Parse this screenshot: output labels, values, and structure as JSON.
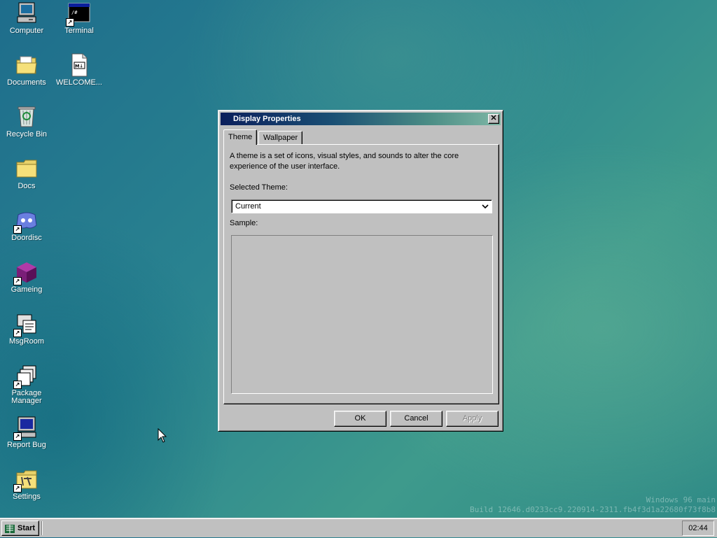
{
  "desktop": {
    "icons": [
      {
        "label": "Computer",
        "icon": "computer-icon"
      },
      {
        "label": "Terminal",
        "icon": "terminal-icon"
      },
      {
        "label": "Documents",
        "icon": "documents-folder-icon"
      },
      {
        "label": "WELCOME...",
        "icon": "markdown-file-icon"
      },
      {
        "label": "Recycle Bin",
        "icon": "recycle-bin-icon"
      },
      {
        "label": "Docs",
        "icon": "folder-icon"
      },
      {
        "label": "Doordisc",
        "icon": "doordisc-icon"
      },
      {
        "label": "Gameing",
        "icon": "game-cube-icon"
      },
      {
        "label": "MsgRoom",
        "icon": "msgroom-icon"
      },
      {
        "label": "Package Manager",
        "icon": "package-manager-icon"
      },
      {
        "label": "Report Bug",
        "icon": "report-bug-icon"
      },
      {
        "label": "Settings",
        "icon": "settings-icon"
      }
    ],
    "terminal_glyph": "/#",
    "md_glyph": "M↓"
  },
  "dialog": {
    "title": "Display Properties",
    "close_glyph": "✕",
    "tabs": [
      {
        "label": "Theme",
        "active": true
      },
      {
        "label": "Wallpaper",
        "active": false
      }
    ],
    "description": "A theme is a set of icons, visual styles, and sounds to alter the core experience of the user interface.",
    "selected_theme_label": "Selected Theme:",
    "selected_theme_value": "Current",
    "sample_label": "Sample:",
    "buttons": {
      "ok": "OK",
      "cancel": "Cancel",
      "apply": "Apply"
    }
  },
  "watermark": {
    "line1": "Windows 96 main",
    "line2": "Build 12646.d0233cc9.220914-2311.fb4f3d1a22680f73f8b8"
  },
  "taskbar": {
    "start_label": "Start",
    "clock": "02:44"
  },
  "colors": {
    "title_gradient_start": "#0b1f5c",
    "title_gradient_end": "#7fb7a6",
    "face": "#c0c0c0",
    "wallpaper": "#2a8490"
  }
}
